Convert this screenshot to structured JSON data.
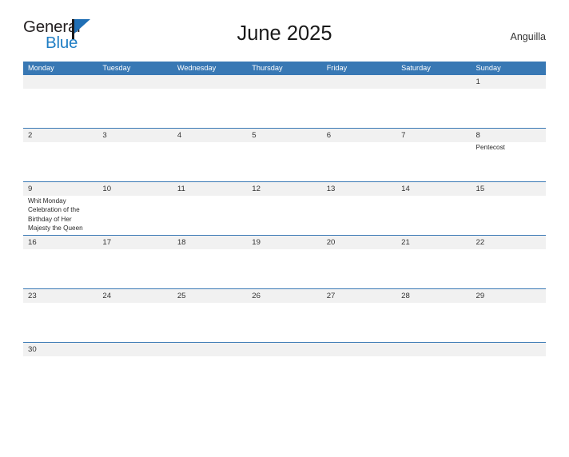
{
  "brand": {
    "word1": "General",
    "word2": "Blue"
  },
  "header": {
    "title": "June 2025",
    "country": "Anguilla"
  },
  "calendar": {
    "day_names": [
      "Monday",
      "Tuesday",
      "Wednesday",
      "Thursday",
      "Friday",
      "Saturday",
      "Sunday"
    ],
    "header_color": "#3878b4",
    "datebar_color": "#f1f1f1",
    "weeks": [
      {
        "days": [
          {
            "num": "",
            "events": []
          },
          {
            "num": "",
            "events": []
          },
          {
            "num": "",
            "events": []
          },
          {
            "num": "",
            "events": []
          },
          {
            "num": "",
            "events": []
          },
          {
            "num": "",
            "events": []
          },
          {
            "num": "1",
            "events": []
          }
        ]
      },
      {
        "days": [
          {
            "num": "2",
            "events": []
          },
          {
            "num": "3",
            "events": []
          },
          {
            "num": "4",
            "events": []
          },
          {
            "num": "5",
            "events": []
          },
          {
            "num": "6",
            "events": []
          },
          {
            "num": "7",
            "events": []
          },
          {
            "num": "8",
            "events": [
              "Pentecost"
            ]
          }
        ]
      },
      {
        "days": [
          {
            "num": "9",
            "events": [
              "Whit Monday",
              "Celebration of the Birthday of Her Majesty the Queen"
            ]
          },
          {
            "num": "10",
            "events": []
          },
          {
            "num": "11",
            "events": []
          },
          {
            "num": "12",
            "events": []
          },
          {
            "num": "13",
            "events": []
          },
          {
            "num": "14",
            "events": []
          },
          {
            "num": "15",
            "events": []
          }
        ]
      },
      {
        "days": [
          {
            "num": "16",
            "events": []
          },
          {
            "num": "17",
            "events": []
          },
          {
            "num": "18",
            "events": []
          },
          {
            "num": "19",
            "events": []
          },
          {
            "num": "20",
            "events": []
          },
          {
            "num": "21",
            "events": []
          },
          {
            "num": "22",
            "events": []
          }
        ]
      },
      {
        "days": [
          {
            "num": "23",
            "events": []
          },
          {
            "num": "24",
            "events": []
          },
          {
            "num": "25",
            "events": []
          },
          {
            "num": "26",
            "events": []
          },
          {
            "num": "27",
            "events": []
          },
          {
            "num": "28",
            "events": []
          },
          {
            "num": "29",
            "events": []
          }
        ]
      },
      {
        "days": [
          {
            "num": "30",
            "events": []
          },
          {
            "num": "",
            "events": []
          },
          {
            "num": "",
            "events": []
          },
          {
            "num": "",
            "events": []
          },
          {
            "num": "",
            "events": []
          },
          {
            "num": "",
            "events": []
          },
          {
            "num": "",
            "events": []
          }
        ]
      }
    ]
  }
}
